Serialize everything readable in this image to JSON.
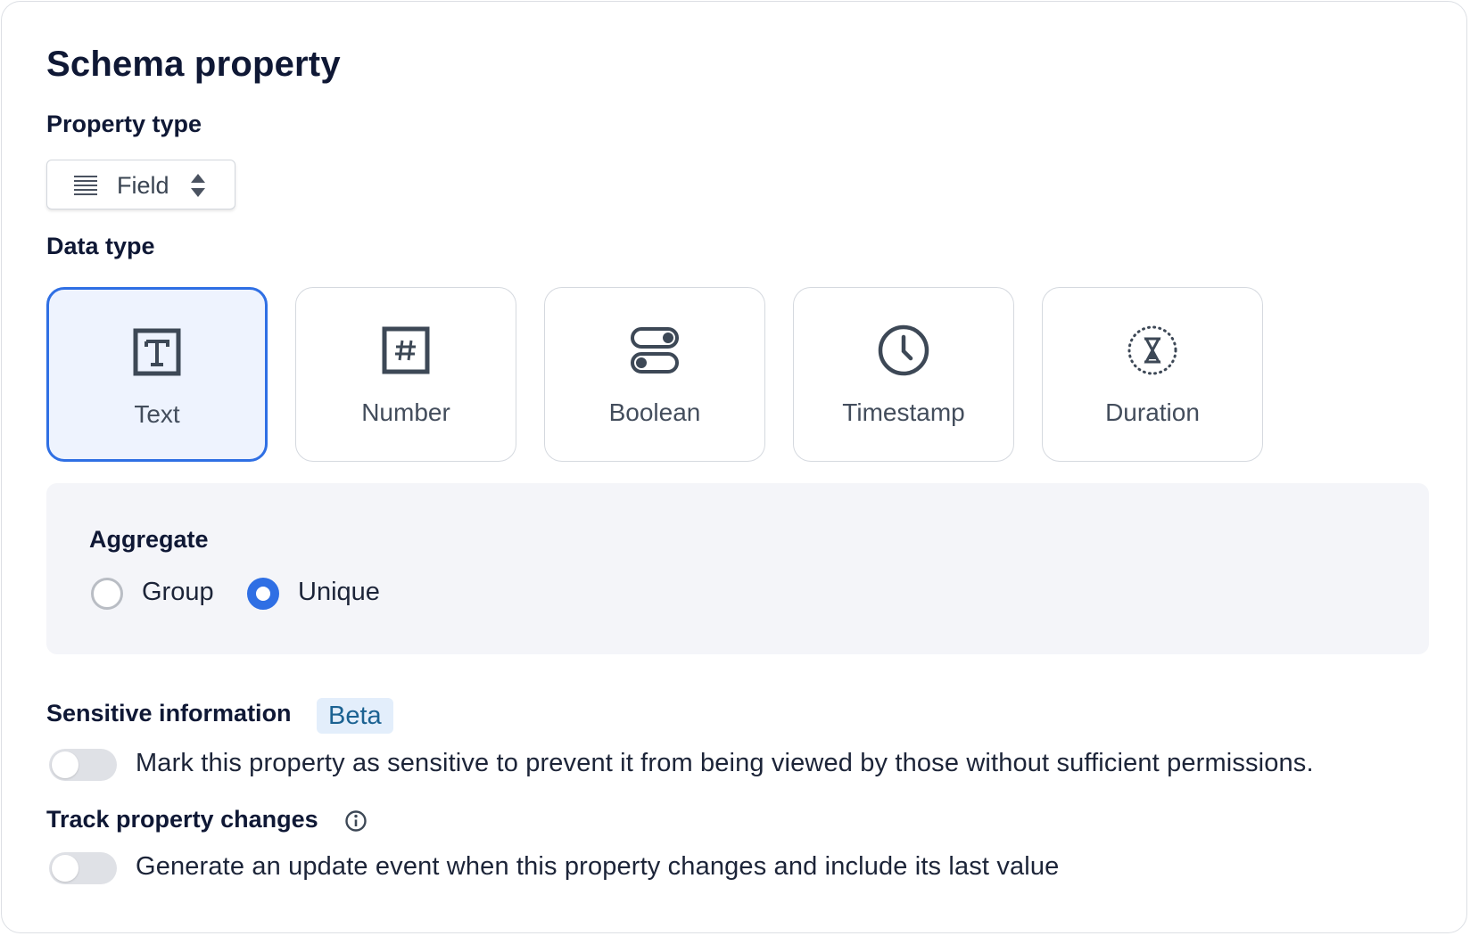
{
  "panel": {
    "title": "Schema property"
  },
  "property_type": {
    "label": "Property type",
    "selected": "Field",
    "icon": "list-lines-icon"
  },
  "data_type": {
    "label": "Data type",
    "options": [
      {
        "label": "Text",
        "icon": "text-icon",
        "selected": true
      },
      {
        "label": "Number",
        "icon": "hash-icon",
        "selected": false
      },
      {
        "label": "Boolean",
        "icon": "toggle-icon",
        "selected": false
      },
      {
        "label": "Timestamp",
        "icon": "clock-icon",
        "selected": false
      },
      {
        "label": "Duration",
        "icon": "hourglass-icon",
        "selected": false
      }
    ]
  },
  "aggregate": {
    "label": "Aggregate",
    "options": [
      {
        "label": "Group",
        "selected": false
      },
      {
        "label": "Unique",
        "selected": true
      }
    ]
  },
  "sensitive": {
    "label": "Sensitive information",
    "badge": "Beta",
    "enabled": false,
    "description": "Mark this property as sensitive to prevent it from being viewed by those without sufficient permissions."
  },
  "track_changes": {
    "label": "Track property changes",
    "enabled": false,
    "description": "Generate an update event when this property changes and include its last value"
  },
  "colors": {
    "accent": "#2f6fe4",
    "selected_card_bg": "#eef3fe",
    "badge_bg": "#e3eefb",
    "badge_text": "#1b6292"
  }
}
